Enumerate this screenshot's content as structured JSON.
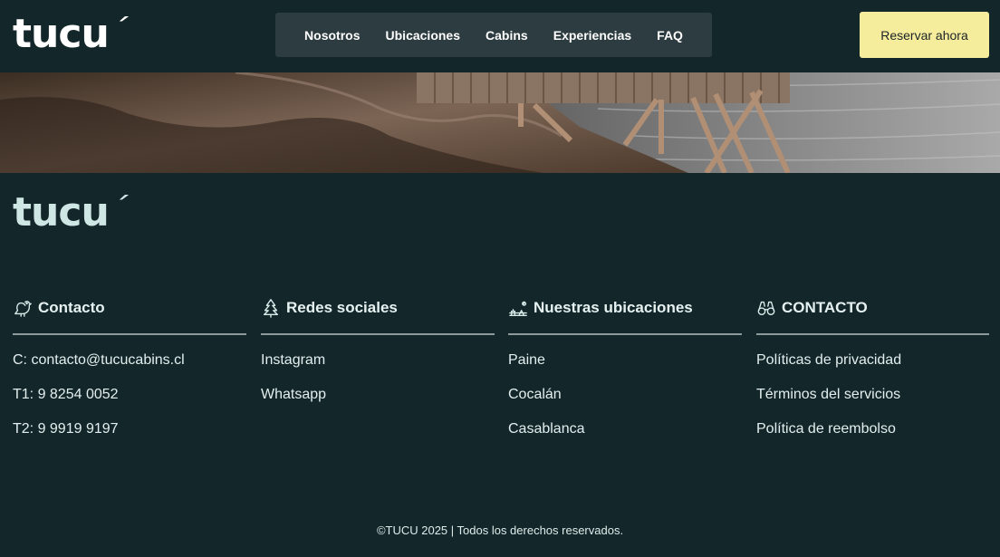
{
  "brand": {
    "logo_text": "tucu",
    "logo_mark": "´"
  },
  "nav": {
    "items": [
      "Nosotros",
      "Ubicaciones",
      "Cabins",
      "Experiencias",
      "FAQ"
    ]
  },
  "header": {
    "reserve_label": "Reservar ahora"
  },
  "colors": {
    "background": "#13262a",
    "nav_bg": "#2d3c40",
    "accent": "#f5ec9c",
    "rule": "#8c9a9b"
  },
  "footer": {
    "columns": [
      {
        "icon": "bird-icon",
        "title": "Contacto",
        "items": [
          "C: contacto@tucucabins.cl",
          "T1: 9 8254 0052",
          "T2: 9 9919 9197"
        ]
      },
      {
        "icon": "tree-icon",
        "title": "Redes sociales",
        "items": [
          "Instagram",
          "Whatsapp"
        ]
      },
      {
        "icon": "landscape-icon",
        "title": "Nuestras ubicaciones",
        "items": [
          "Paine",
          "Cocalán",
          "Casablanca"
        ]
      },
      {
        "icon": "binoculars-icon",
        "title": "CONTACTO",
        "items": [
          "Políticas de privacidad",
          "Términos del servicios",
          "Política de reembolso"
        ]
      }
    ],
    "copyright": "©TUCU 2025 | Todos los derechos reservados."
  }
}
